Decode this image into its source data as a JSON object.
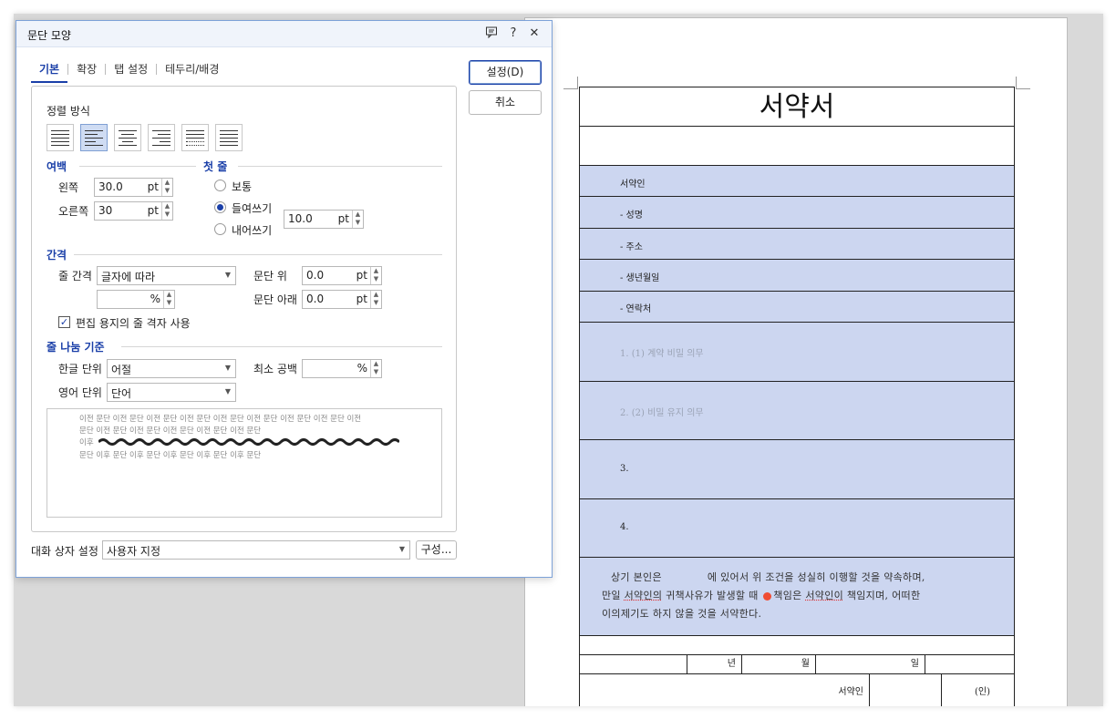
{
  "dialog": {
    "title": "문단 모양",
    "tabs": [
      "기본",
      "확장",
      "탭 설정",
      "테두리/배경"
    ],
    "buttons": {
      "ok": "설정(D)",
      "cancel": "취소",
      "compose": "구성..."
    },
    "alignment": {
      "label": "정렬 방식",
      "options": [
        "양쪽 정렬",
        "왼쪽 정렬",
        "가운데 정렬",
        "오른쪽 정렬",
        "배분 정렬",
        "나눔 정렬"
      ],
      "selected": "왼쪽 정렬"
    },
    "margin": {
      "label": "여백",
      "left_label": "왼쪽",
      "left_value": "30.0",
      "left_unit": "pt",
      "right_label": "오른쪽",
      "right_value": "30",
      "right_unit": "pt"
    },
    "first_line": {
      "label": "첫 줄",
      "options": [
        "보통",
        "들여쓰기",
        "내어쓰기"
      ],
      "selected": "들여쓰기",
      "value": "10.0",
      "unit": "pt"
    },
    "spacing": {
      "label": "간격",
      "line_label": "줄 간격",
      "line_mode": "글자에 따라",
      "line_value": "",
      "line_unit": "%",
      "before_label": "문단 위",
      "before_value": "0.0",
      "before_unit": "pt",
      "after_label": "문단 아래",
      "after_value": "0.0",
      "after_unit": "pt",
      "grid_label": "편집 용지의 줄 격자 사용",
      "grid_checked": true
    },
    "line_break": {
      "label": "줄 나눔 기준",
      "hangul_label": "한글 단위",
      "hangul_value": "어절",
      "min_space_label": "최소 공백",
      "min_space_value": "",
      "min_space_unit": "%",
      "english_label": "영어 단위",
      "english_value": "단어"
    },
    "preview": {
      "line1": "이전 문단 이전 문단 이전 문단 이전 문단 이전 문단 이전 문단 이전 문단 이전 문단 이전",
      "line2": "문단 이전 문단 이전 문단 이전 문단 이전 문단 이전 문단",
      "line3_prefix": "이후",
      "line4": "문단 이후 문단 이후 문단 이후 문단 이후 문단 이후 문단"
    },
    "dialog_setting_label": "대화 상자 설정",
    "dialog_setting_value": "사용자 지정"
  },
  "document": {
    "title": "서약서",
    "rows": [
      "서약인",
      "- 성명",
      "- 주소",
      "- 생년월일",
      "- 연락처"
    ],
    "items": [
      {
        "text": "1. (1) 계약 비밀 의무",
        "faint": true
      },
      {
        "text": "2. (2) 비밀 유지 의무",
        "faint": true
      },
      {
        "text": "3.",
        "faint": false
      },
      {
        "text": "4.",
        "faint": false
      }
    ],
    "pledge_line1_a": "상기 본인은",
    "pledge_line1_b": "에 있어서 위 조건을 성실히 이행할 것을 약속하며,",
    "pledge_line2_a": "만일",
    "pledge_line2_ul1": "서약인의",
    "pledge_line2_b": "귀책사유가 발생할 때",
    "pledge_line2_c": "책임은",
    "pledge_line2_ul2": "서약인이",
    "pledge_line2_d": "책임지며, 어떠한",
    "pledge_line3": "이의제기도 하지 않을 것을 서약한다.",
    "date_labels": [
      "년",
      "월",
      "일"
    ],
    "signer_label": "서약인",
    "seal_label": "(인)"
  }
}
